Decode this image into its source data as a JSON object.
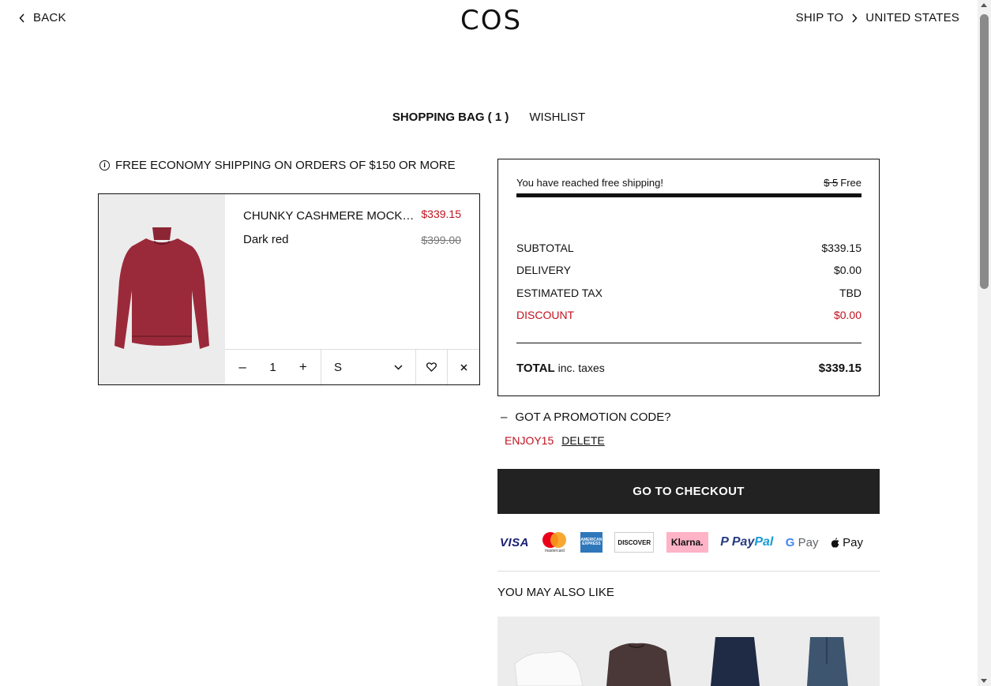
{
  "header": {
    "back_label": "BACK",
    "logo": "COS",
    "ship_to_label": "SHIP TO",
    "ship_to_country": "UNITED STATES"
  },
  "tabs": [
    {
      "label": "SHOPPING BAG ( 1 )",
      "active": true
    },
    {
      "label": "WISHLIST",
      "active": false
    }
  ],
  "notice": {
    "text": "FREE ECONOMY SHIPPING ON ORDERS OF $150 OR MORE",
    "icon": "info-icon"
  },
  "bag": {
    "items": [
      {
        "name": "CHUNKY CASHMERE MOCK-NECK JUMPER",
        "price": "$339.15",
        "original_price": "$399.00",
        "color": "Dark red",
        "quantity": "1",
        "size": "S"
      }
    ]
  },
  "summary": {
    "free_shipping_message": "You have reached free shipping!",
    "shipping_old": "$ 5",
    "shipping_new": "Free",
    "progress": 1.0,
    "rows": [
      {
        "label": "SUBTOTAL",
        "value": "$339.15"
      },
      {
        "label": "DELIVERY",
        "value": "$0.00"
      },
      {
        "label": "ESTIMATED TAX",
        "value": "TBD"
      },
      {
        "label": "DISCOUNT",
        "value": "$0.00"
      }
    ],
    "total_label": "TOTAL",
    "total_sub": "inc. taxes",
    "total_value": "$339.15"
  },
  "promo": {
    "toggle_label": "GOT A PROMOTION CODE?",
    "toggle_symbol": "–",
    "code": "ENJOY15",
    "delete_label": "DELETE"
  },
  "checkout_label": "GO TO CHECKOUT",
  "payments": {
    "visa": "VISA",
    "mastercard_caption": "mastercard",
    "amex": "AMERICAN EXPRESS",
    "discover": "DISCOVER",
    "klarna": "Klarna.",
    "paypal_a": "Pay",
    "paypal_b": "Pal",
    "gpay": "Pay",
    "apay": "Pay"
  },
  "also_like": "YOU MAY ALSO LIKE",
  "colors": {
    "accent_red": "#c1121f",
    "dark": "#222222"
  }
}
